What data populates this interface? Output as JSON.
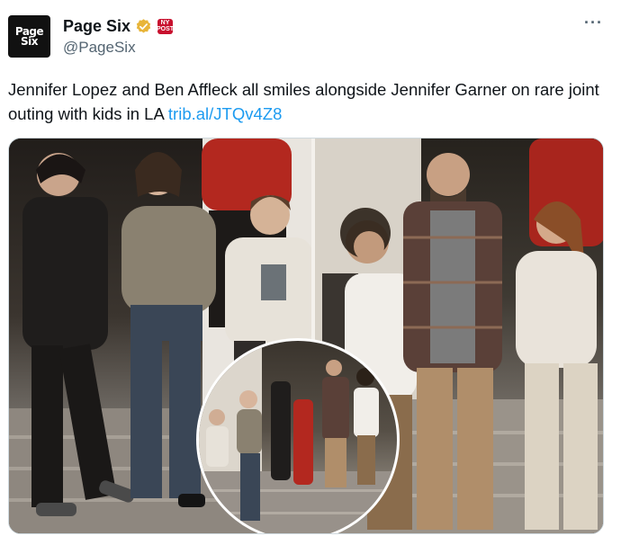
{
  "author": {
    "display_name": "Page Six",
    "handle": "@PageSix",
    "avatar_text": [
      "Page",
      "Six"
    ],
    "verified_color": "#e8b53a",
    "affiliate_badge_text": "NY POST"
  },
  "tweet": {
    "text": "Jennifer Lopez and Ben Affleck all smiles alongside Jennifer Garner on rare joint outing with kids in LA ",
    "link": "trib.al/JTQv4Z8"
  },
  "more_label": "···",
  "colors": {
    "link": "#1d9bf0",
    "text": "#0f1419",
    "secondary": "#536471"
  }
}
